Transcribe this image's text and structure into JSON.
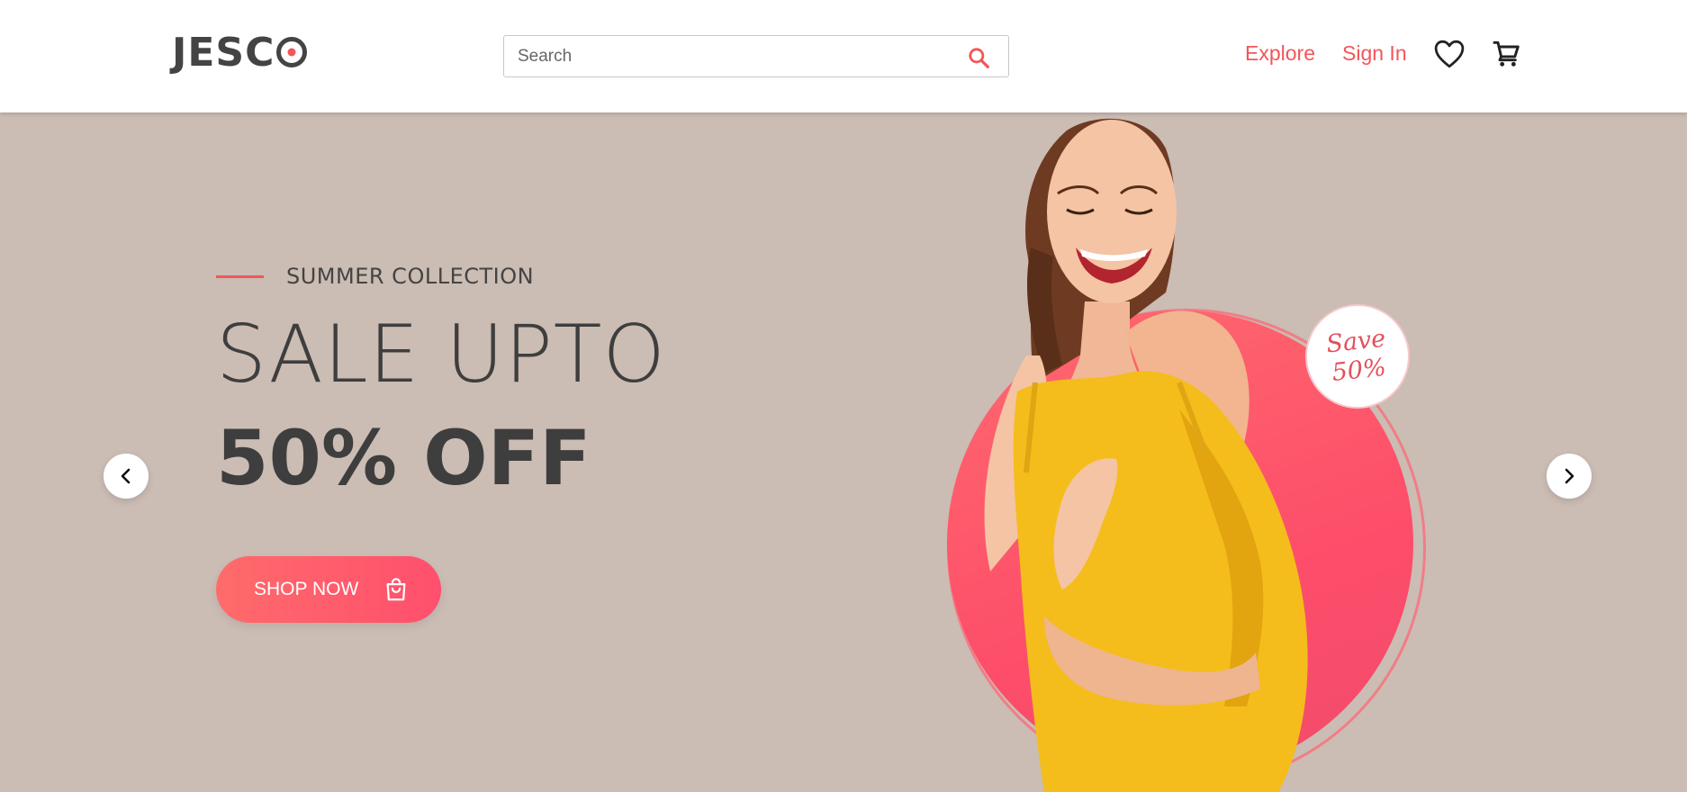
{
  "header": {
    "logo_text": "JESC",
    "search": {
      "placeholder": "Search",
      "value": ""
    },
    "nav": {
      "explore": "Explore",
      "sign_in": "Sign In"
    },
    "icons": [
      "search-icon",
      "heart-icon",
      "cart-icon"
    ]
  },
  "hero": {
    "eyebrow": "SUMMER COLLECTION",
    "headline_1": "SALE UPTO",
    "headline_2": "50% OFF",
    "cta_label": "SHOP NOW",
    "badge": {
      "line1": "Save",
      "line2": "50%"
    },
    "icons": [
      "chevron-left-icon",
      "chevron-right-icon",
      "shopping-bag-icon"
    ]
  },
  "colors": {
    "accent": "#f3555a",
    "hero_bg": "#cbbcb4",
    "text_dark": "#3e3e3e",
    "dress": "#f4bd1c"
  }
}
